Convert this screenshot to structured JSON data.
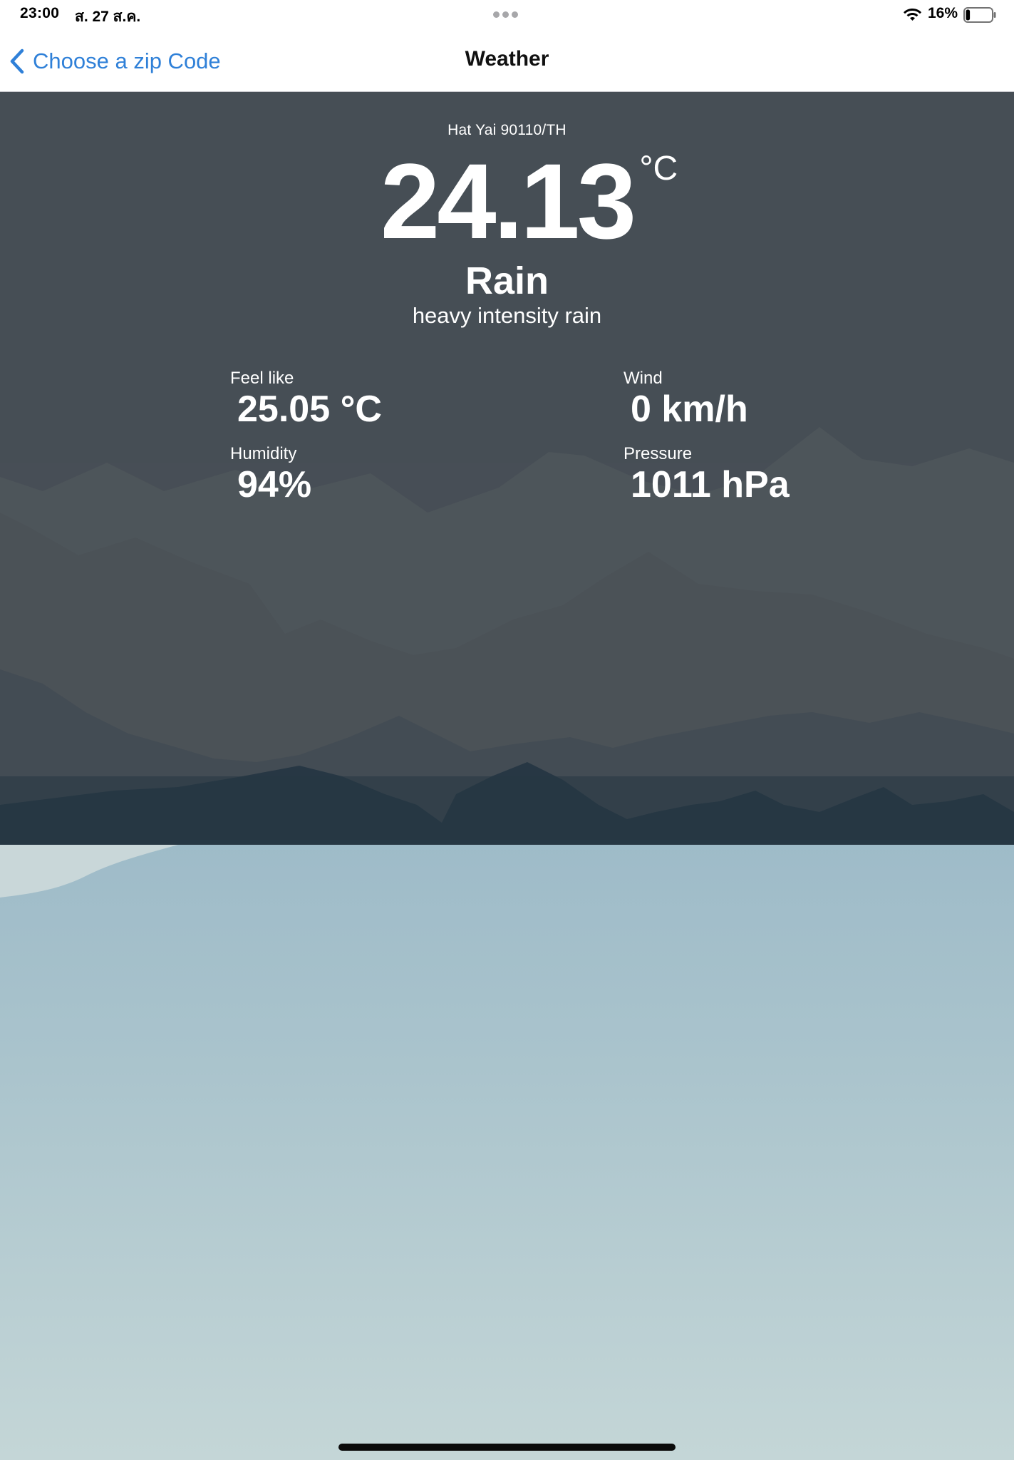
{
  "status_bar": {
    "time": "23:00",
    "date": "ส. 27 ส.ค.",
    "battery_percent": "16%",
    "battery_level": 0.16,
    "icons": [
      "wifi-icon",
      "battery-icon",
      "multitask-dots-icon"
    ]
  },
  "nav": {
    "back_label": "Choose a zip Code",
    "title": "Weather",
    "accent_color": "#2f80d8"
  },
  "weather": {
    "location": "Hat Yai 90110/TH",
    "temperature": "24.13",
    "temperature_unit": "°C",
    "condition": "Rain",
    "description": "heavy intensity rain",
    "stats": {
      "feels_like": {
        "label": "Feel like",
        "value": "25.05 °C"
      },
      "wind": {
        "label": "Wind",
        "value": "0 km/h"
      },
      "humidity": {
        "label": "Humidity",
        "value": "94%"
      },
      "pressure": {
        "label": "Pressure",
        "value": "1011 hPa"
      }
    }
  },
  "colors": {
    "overlay": "#4a5058",
    "sky_top": "#5f8ea8",
    "sky_bottom": "#c4d6d7",
    "mountain_dark": "#25394a"
  }
}
